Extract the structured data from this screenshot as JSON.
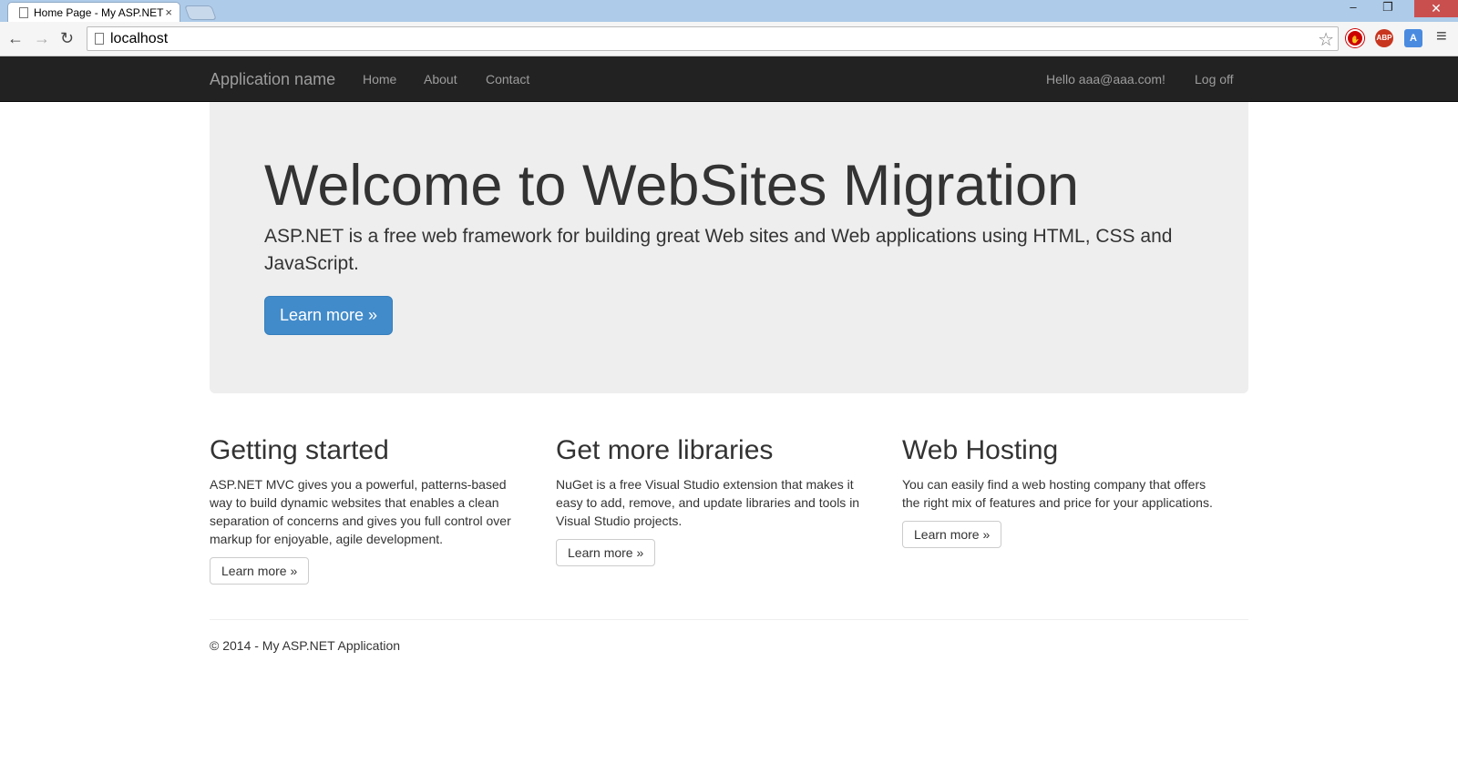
{
  "browser": {
    "tab_title": "Home Page - My ASP.NET",
    "tab_close": "×",
    "url": "localhost",
    "min": "–",
    "max": "❐",
    "close": "✕",
    "back": "←",
    "forward": "→",
    "reload": "↻",
    "star": "☆",
    "menu": "≡",
    "ext_stop": "✋",
    "ext_abp": "ABP",
    "ext_translate": "A"
  },
  "navbar": {
    "brand": "Application name",
    "links": [
      "Home",
      "About",
      "Contact"
    ],
    "hello": "Hello aaa@aaa.com!",
    "logoff": "Log off"
  },
  "jumbotron": {
    "title": "Welcome to WebSites Migration",
    "lead": "ASP.NET is a free web framework for building great Web sites and Web applications using HTML, CSS and JavaScript.",
    "button": "Learn more »"
  },
  "columns": [
    {
      "title": "Getting started",
      "text": "ASP.NET MVC gives you a powerful, patterns-based way to build dynamic websites that enables a clean separation of concerns and gives you full control over markup for enjoyable, agile development.",
      "button": "Learn more »"
    },
    {
      "title": "Get more libraries",
      "text": "NuGet is a free Visual Studio extension that makes it easy to add, remove, and update libraries and tools in Visual Studio projects.",
      "button": "Learn more »"
    },
    {
      "title": "Web Hosting",
      "text": "You can easily find a web hosting company that offers the right mix of features and price for your applications.",
      "button": "Learn more »"
    }
  ],
  "footer": "© 2014 - My ASP.NET Application",
  "colors": {
    "navbar": "#222222",
    "primary": "#428bca",
    "jumbotron": "#eeeeee"
  }
}
